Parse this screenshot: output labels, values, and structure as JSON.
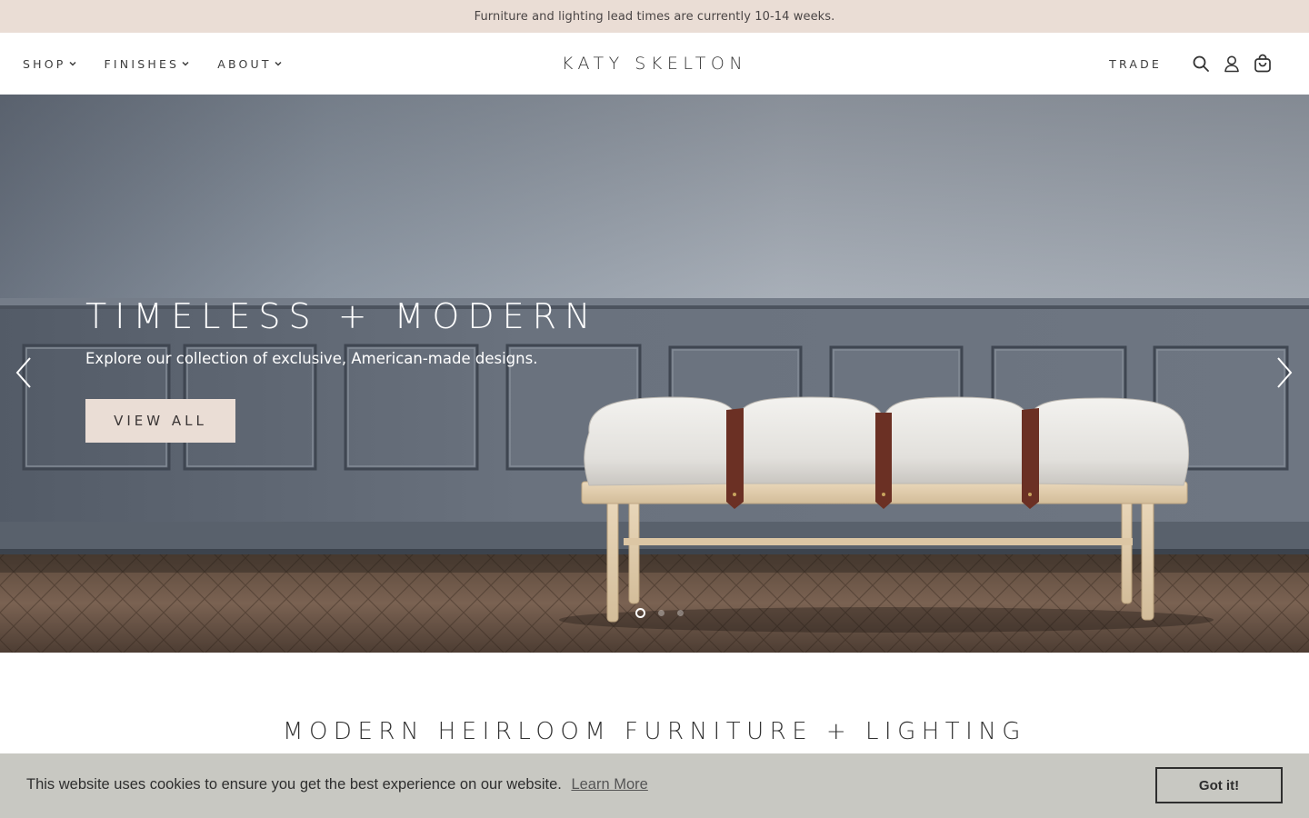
{
  "announcement": {
    "text": "Furniture and lighting lead times are currently 10-14 weeks."
  },
  "header": {
    "nav_left": [
      {
        "label": "SHOP"
      },
      {
        "label": "FINISHES"
      },
      {
        "label": "ABOUT"
      }
    ],
    "logo": "KATY SKELTON",
    "trade_label": "TRADE",
    "icons": [
      "search-icon",
      "account-icon",
      "cart-icon"
    ]
  },
  "hero": {
    "title": "TIMELESS + MODERN",
    "subtitle": "Explore our collection of exclusive, American-made designs.",
    "cta_label": "VIEW ALL",
    "slide_count": 3,
    "active_slide": 1
  },
  "section": {
    "heading": "MODERN HEIRLOOM FURNITURE + LIGHTING"
  },
  "cookie": {
    "message": "This website uses cookies to ensure you get the best experience on our website.",
    "link_label": "Learn More",
    "button_label": "Got it!"
  },
  "colors": {
    "accent_blush": "#eaddd5",
    "cookie_bar": "#c8c8c2",
    "text_dark": "#333333"
  }
}
